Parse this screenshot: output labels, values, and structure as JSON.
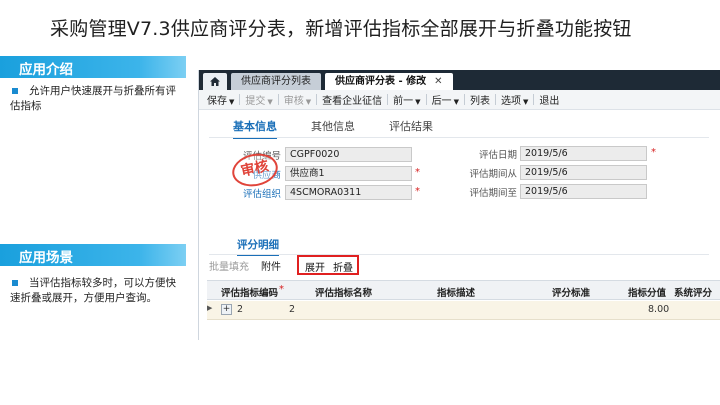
{
  "slide": {
    "title": "采购管理V7.3供应商评分表，新增评估指标全部展开与折叠功能按钮",
    "intro": {
      "heading": "应用介绍",
      "text": "允许用户快速展开与折叠所有评估指标"
    },
    "scenario": {
      "heading": "应用场景",
      "text": "当评估指标较多时，可以方便快速折叠或展开，方便用户查询。"
    }
  },
  "app": {
    "tabs": [
      {
        "label": "供应商评分列表"
      },
      {
        "label": "供应商评分表 - 修改"
      }
    ],
    "toolbar": {
      "save": "保存",
      "submit": "提交",
      "audit": "审核",
      "check_credit": "查看企业征信",
      "prev": "前一",
      "next": "后一",
      "list": "列表",
      "options": "选项",
      "exit": "退出"
    },
    "subtabs": [
      "基本信息",
      "其他信息",
      "评估结果"
    ],
    "stamp_text": "审核",
    "form": {
      "code_label": "评估编号",
      "code_value": "CGPF0020",
      "supplier_label": "供应商",
      "supplier_value": "供应商1",
      "org_label": "评估组织",
      "org_value": "4SCMORA0311",
      "date_label": "评估日期",
      "date_value": "2019/5/6",
      "from_label": "评估期间从",
      "from_value": "2019/5/6",
      "to_label": "评估期间至",
      "to_value": "2019/5/6"
    },
    "detail": {
      "title": "评分明细",
      "batch_fill": "批量填充",
      "attachment": "附件",
      "expand": "展开",
      "collapse": "折叠",
      "columns": [
        "评估指标编码",
        "评估指标名称",
        "指标描述",
        "评分标准",
        "指标分值",
        "系统评分"
      ],
      "row": {
        "code": "2",
        "name": "2",
        "score": "8.00"
      }
    }
  },
  "colors": {
    "accent": "#1a6fb8",
    "section_bar": "#1aa0dd",
    "highlight": "#e02020"
  }
}
